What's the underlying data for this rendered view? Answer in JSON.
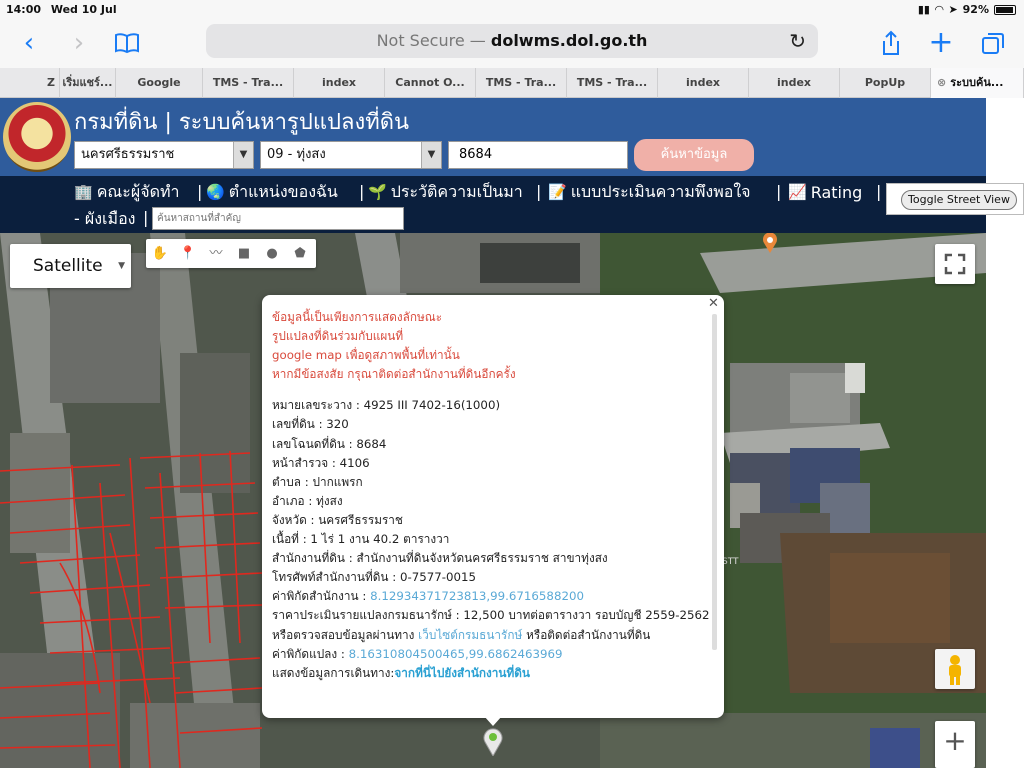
{
  "status_bar": {
    "time": "14:00",
    "date": "Wed 10 Jul",
    "battery": "92%"
  },
  "browser": {
    "address_prefix": "Not Secure —",
    "address_domain": "dolwms.dol.go.th",
    "tabs": [
      {
        "label": "Z"
      },
      {
        "label": "เริ่มแชร์..."
      },
      {
        "label": "Google"
      },
      {
        "label": "TMS - Tra..."
      },
      {
        "label": "index"
      },
      {
        "label": "Cannot O..."
      },
      {
        "label": "TMS - Tra..."
      },
      {
        "label": "TMS - Tra..."
      },
      {
        "label": "index"
      },
      {
        "label": "index"
      },
      {
        "label": "PopUp"
      },
      {
        "label": "ระบบค้น..."
      }
    ]
  },
  "header": {
    "title": "กรมที่ดิน | ระบบค้นหารูปแปลงที่ดิน",
    "province": "นครศรีธรรมราช",
    "district": "09 - ทุ่งสง",
    "parcel_number": "8684",
    "search_button": "ค้นหาข้อมูล"
  },
  "nav": {
    "items": [
      {
        "label": "คณะผู้จัดทำ"
      },
      {
        "label": "ตำแหน่งของฉัน"
      },
      {
        "label": "ประวัติความเป็นมา"
      },
      {
        "label": "แบบประเมินความพึงพอใจ"
      },
      {
        "label": "Rating"
      }
    ],
    "second_row_label": "- ผังเมือง",
    "place_placeholder": "ค้นหาสถานที่สำคัญ",
    "toggle_street_view": "Toggle Street View"
  },
  "map": {
    "type_label": "Satellite",
    "road_label": "STT",
    "tools": [
      "hand-icon",
      "marker-icon",
      "line-icon",
      "rectangle-icon",
      "circle-icon",
      "polygon-icon"
    ]
  },
  "popup": {
    "disclaimer": [
      "ข้อมูลนี้เป็นเพียงการแสดงลักษณะ",
      "รูปแปลงที่ดินร่วมกับแผนที่",
      "google map เพื่อดูสภาพพื้นที่เท่านั้น",
      "หากมีข้อสงสัย กรุณาติดต่อสำนักงานที่ดินอีกครั้ง"
    ],
    "map_sheet": "หมายเลขระวาง : 4925 III 7402-16(1000)",
    "land_no": "เลขที่ดิน : 320",
    "deed_no": "เลขโฉนดที่ดิน : 8684",
    "survey_page": "หน้าสำรวจ : 4106",
    "subdistrict": "ตำบล : ปากแพรก",
    "district": "อำเภอ : ทุ่งสง",
    "province": "จังหวัด : นครศรีธรรมราช",
    "area": "เนื้อที่ : 1 ไร่ 1 งาน 40.2 ตารางวา",
    "land_office": "สำนักงานที่ดิน : สำนักงานที่ดินจังหวัดนครศรีธรรมราช สาขาทุ่งสง",
    "phone": "โทรศัพท์สำนักงานที่ดิน : 0-7577-0015",
    "office_coord_label": "ค่าพิกัดสำนักงาน : ",
    "office_coord": "8.12934371723813,99.6716588200",
    "appraisal": "ราคาประเมินรายแปลงกรมธนารักษ์ : 12,500 บาทต่อตารางวา รอบบัญชี 2559-2562",
    "check_prefix": "หรือตรวจสอบข้อมูลผ่านทาง ",
    "check_link": "เว็บไซต์กรมธนารักษ์",
    "check_suffix": " หรือติดต่อสำนักงานที่ดิน",
    "parcel_coord_label": "ค่าพิกัดแปลง : ",
    "parcel_coord": "8.16310804500465,99.6862463969",
    "directions_prefix": "แสดงข้อมูลการเดินทาง:",
    "directions_link": "จากที่นี่ไปยังสำนักงานที่ดิน"
  },
  "colors": {
    "header_bg": "#2f5c9c",
    "nav_bg": "#0b1f3d",
    "warning_text": "#d94a3c",
    "link": "#5aa9d6",
    "parcel_lines": "#e0281e",
    "safari_accent": "#1a7cf5"
  }
}
